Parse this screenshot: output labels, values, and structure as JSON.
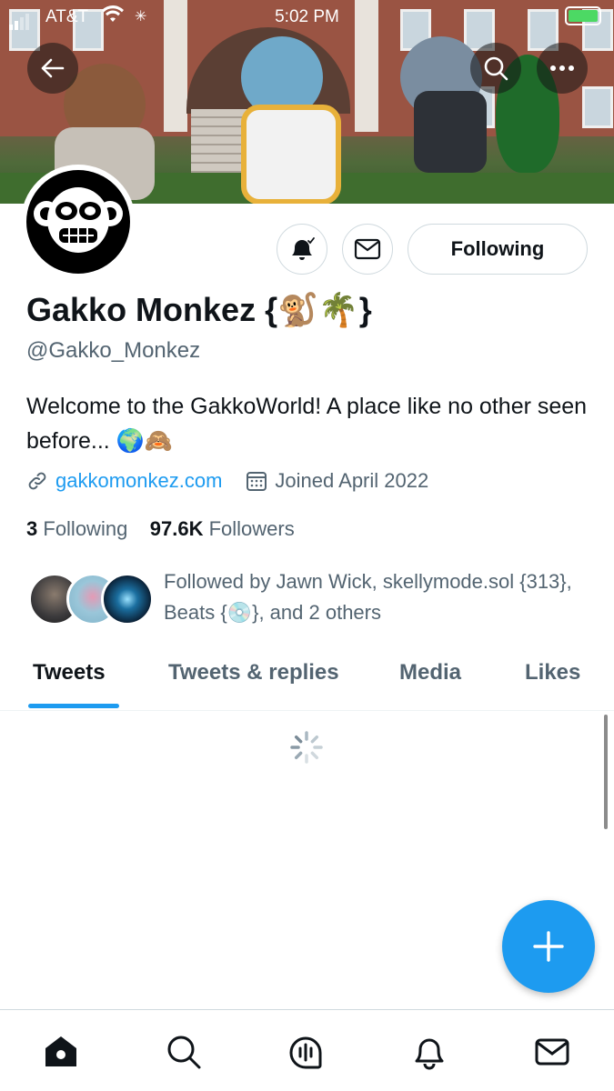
{
  "status_bar": {
    "carrier": "AT&T",
    "time": "5:02 PM"
  },
  "profile": {
    "name": "Gakko Monkez {🐒🌴}",
    "handle": "@Gakko_Monkez",
    "bio": "Welcome to the GakkoWorld! A place like no other seen before... 🌍🙈",
    "website": "gakkomonkez.com",
    "joined": "Joined April 2022",
    "following_count": "3",
    "following_label": "Following",
    "followers_count": "97.6K",
    "followers_label": "Followers",
    "followed_by": "Followed by Jawn Wick, skellymode.sol {313}, Beats {💿}, and 2 others"
  },
  "actions": {
    "following_button": "Following"
  },
  "tabs": [
    {
      "label": "Tweets",
      "active": true
    },
    {
      "label": "Tweets & replies",
      "active": false
    },
    {
      "label": "Media",
      "active": false
    },
    {
      "label": "Likes",
      "active": false
    }
  ],
  "icons": {
    "back": "arrow-left-icon",
    "search": "search-icon",
    "more": "more-icon",
    "notify": "bell-check-icon",
    "message": "mail-icon",
    "link": "link-icon",
    "calendar": "calendar-icon",
    "compose": "plus-icon",
    "nav": [
      "home-icon",
      "search-icon",
      "spaces-icon",
      "notifications-icon",
      "messages-icon"
    ]
  },
  "colors": {
    "accent": "#1d9bf0",
    "text_primary": "#0f1419",
    "text_secondary": "#536471",
    "battery": "#4cd964"
  }
}
